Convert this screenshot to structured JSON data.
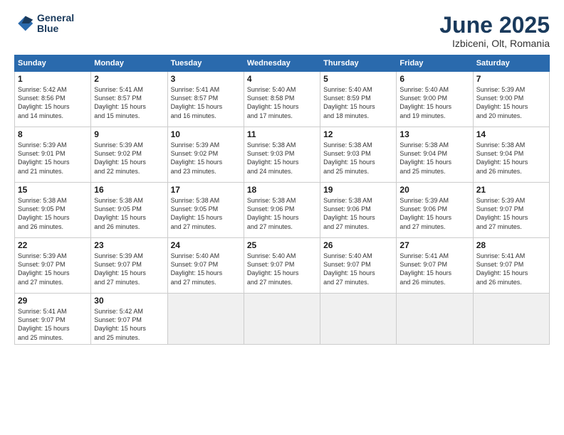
{
  "logo": {
    "line1": "General",
    "line2": "Blue"
  },
  "title": "June 2025",
  "subtitle": "Izbiceni, Olt, Romania",
  "weekdays": [
    "Sunday",
    "Monday",
    "Tuesday",
    "Wednesday",
    "Thursday",
    "Friday",
    "Saturday"
  ],
  "weeks": [
    [
      {
        "day": "1",
        "info": "Sunrise: 5:42 AM\nSunset: 8:56 PM\nDaylight: 15 hours\nand 14 minutes."
      },
      {
        "day": "2",
        "info": "Sunrise: 5:41 AM\nSunset: 8:57 PM\nDaylight: 15 hours\nand 15 minutes."
      },
      {
        "day": "3",
        "info": "Sunrise: 5:41 AM\nSunset: 8:57 PM\nDaylight: 15 hours\nand 16 minutes."
      },
      {
        "day": "4",
        "info": "Sunrise: 5:40 AM\nSunset: 8:58 PM\nDaylight: 15 hours\nand 17 minutes."
      },
      {
        "day": "5",
        "info": "Sunrise: 5:40 AM\nSunset: 8:59 PM\nDaylight: 15 hours\nand 18 minutes."
      },
      {
        "day": "6",
        "info": "Sunrise: 5:40 AM\nSunset: 9:00 PM\nDaylight: 15 hours\nand 19 minutes."
      },
      {
        "day": "7",
        "info": "Sunrise: 5:39 AM\nSunset: 9:00 PM\nDaylight: 15 hours\nand 20 minutes."
      }
    ],
    [
      {
        "day": "8",
        "info": "Sunrise: 5:39 AM\nSunset: 9:01 PM\nDaylight: 15 hours\nand 21 minutes."
      },
      {
        "day": "9",
        "info": "Sunrise: 5:39 AM\nSunset: 9:02 PM\nDaylight: 15 hours\nand 22 minutes."
      },
      {
        "day": "10",
        "info": "Sunrise: 5:39 AM\nSunset: 9:02 PM\nDaylight: 15 hours\nand 23 minutes."
      },
      {
        "day": "11",
        "info": "Sunrise: 5:38 AM\nSunset: 9:03 PM\nDaylight: 15 hours\nand 24 minutes."
      },
      {
        "day": "12",
        "info": "Sunrise: 5:38 AM\nSunset: 9:03 PM\nDaylight: 15 hours\nand 25 minutes."
      },
      {
        "day": "13",
        "info": "Sunrise: 5:38 AM\nSunset: 9:04 PM\nDaylight: 15 hours\nand 25 minutes."
      },
      {
        "day": "14",
        "info": "Sunrise: 5:38 AM\nSunset: 9:04 PM\nDaylight: 15 hours\nand 26 minutes."
      }
    ],
    [
      {
        "day": "15",
        "info": "Sunrise: 5:38 AM\nSunset: 9:05 PM\nDaylight: 15 hours\nand 26 minutes."
      },
      {
        "day": "16",
        "info": "Sunrise: 5:38 AM\nSunset: 9:05 PM\nDaylight: 15 hours\nand 26 minutes."
      },
      {
        "day": "17",
        "info": "Sunrise: 5:38 AM\nSunset: 9:05 PM\nDaylight: 15 hours\nand 27 minutes."
      },
      {
        "day": "18",
        "info": "Sunrise: 5:38 AM\nSunset: 9:06 PM\nDaylight: 15 hours\nand 27 minutes."
      },
      {
        "day": "19",
        "info": "Sunrise: 5:38 AM\nSunset: 9:06 PM\nDaylight: 15 hours\nand 27 minutes."
      },
      {
        "day": "20",
        "info": "Sunrise: 5:39 AM\nSunset: 9:06 PM\nDaylight: 15 hours\nand 27 minutes."
      },
      {
        "day": "21",
        "info": "Sunrise: 5:39 AM\nSunset: 9:07 PM\nDaylight: 15 hours\nand 27 minutes."
      }
    ],
    [
      {
        "day": "22",
        "info": "Sunrise: 5:39 AM\nSunset: 9:07 PM\nDaylight: 15 hours\nand 27 minutes."
      },
      {
        "day": "23",
        "info": "Sunrise: 5:39 AM\nSunset: 9:07 PM\nDaylight: 15 hours\nand 27 minutes."
      },
      {
        "day": "24",
        "info": "Sunrise: 5:40 AM\nSunset: 9:07 PM\nDaylight: 15 hours\nand 27 minutes."
      },
      {
        "day": "25",
        "info": "Sunrise: 5:40 AM\nSunset: 9:07 PM\nDaylight: 15 hours\nand 27 minutes."
      },
      {
        "day": "26",
        "info": "Sunrise: 5:40 AM\nSunset: 9:07 PM\nDaylight: 15 hours\nand 27 minutes."
      },
      {
        "day": "27",
        "info": "Sunrise: 5:41 AM\nSunset: 9:07 PM\nDaylight: 15 hours\nand 26 minutes."
      },
      {
        "day": "28",
        "info": "Sunrise: 5:41 AM\nSunset: 9:07 PM\nDaylight: 15 hours\nand 26 minutes."
      }
    ],
    [
      {
        "day": "29",
        "info": "Sunrise: 5:41 AM\nSunset: 9:07 PM\nDaylight: 15 hours\nand 25 minutes."
      },
      {
        "day": "30",
        "info": "Sunrise: 5:42 AM\nSunset: 9:07 PM\nDaylight: 15 hours\nand 25 minutes."
      },
      {
        "day": "",
        "info": ""
      },
      {
        "day": "",
        "info": ""
      },
      {
        "day": "",
        "info": ""
      },
      {
        "day": "",
        "info": ""
      },
      {
        "day": "",
        "info": ""
      }
    ]
  ]
}
